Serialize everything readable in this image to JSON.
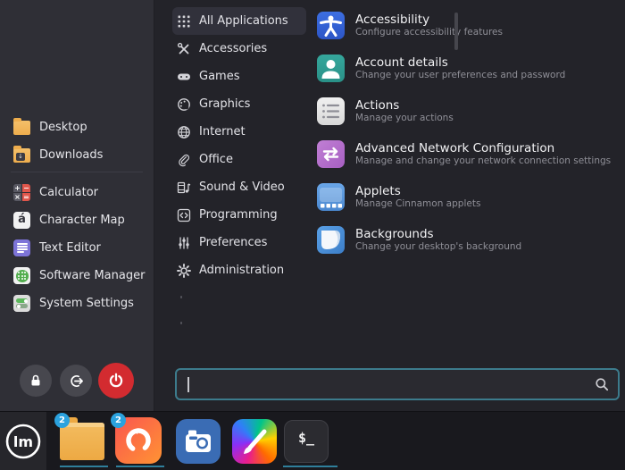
{
  "menu": {
    "sidebar": {
      "places": [
        {
          "label": "Desktop"
        },
        {
          "label": "Downloads"
        }
      ],
      "favorites": [
        {
          "label": "Calculator",
          "calc_glyphs": {
            "plus": "+",
            "minus": "−",
            "times": "×",
            "equals": "="
          }
        },
        {
          "label": "Character Map",
          "glyph": "á"
        },
        {
          "label": "Text Editor"
        },
        {
          "label": "Software Manager"
        },
        {
          "label": "System Settings"
        }
      ],
      "downloads_emblem": "↓"
    },
    "categories": [
      {
        "label": "All Applications",
        "selected": true
      },
      {
        "label": "Accessories"
      },
      {
        "label": "Games"
      },
      {
        "label": "Graphics"
      },
      {
        "label": "Internet"
      },
      {
        "label": "Office"
      },
      {
        "label": "Sound & Video"
      },
      {
        "label": "Programming"
      },
      {
        "label": "Preferences"
      },
      {
        "label": "Administration"
      }
    ],
    "applications": [
      {
        "title": "Accessibility",
        "description": "Configure accessibility features"
      },
      {
        "title": "Account details",
        "description": "Change your user preferences and password"
      },
      {
        "title": "Actions",
        "description": "Manage your actions"
      },
      {
        "title": "Advanced Network Configuration",
        "description": "Manage and change your network connection settings"
      },
      {
        "title": "Applets",
        "description": "Manage Cinnamon applets"
      },
      {
        "title": "Backgrounds",
        "description": "Change your desktop's background"
      }
    ],
    "search": {
      "value": ""
    }
  },
  "taskbar": {
    "logo_monogram": "lm",
    "launchers": [
      {
        "name": "files",
        "badge": "2",
        "running": true
      },
      {
        "name": "firefox",
        "badge": "2",
        "running": true
      },
      {
        "name": "camera",
        "running": false
      },
      {
        "name": "drawing",
        "running": false
      },
      {
        "name": "terminal",
        "glyph": "$_",
        "running": true
      }
    ]
  },
  "colors": {
    "accent_teal": "#3c7b8c",
    "running_indicator": "#2f7f9b",
    "badge_blue": "#2ba2de",
    "shutdown_red": "#d32b30",
    "sidebar_bg": "#2f2f36",
    "menu_bg": "#232329",
    "taskbar_bg": "#19191e"
  }
}
